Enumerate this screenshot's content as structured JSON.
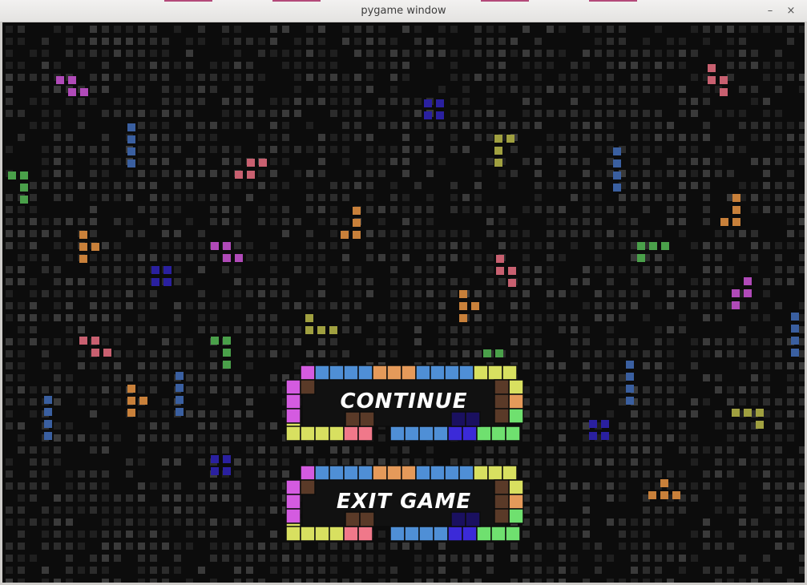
{
  "window": {
    "title": "pygame window",
    "minimize_glyph": "–",
    "close_glyph": "×"
  },
  "menu": {
    "continue_label": "CONTINUE",
    "exit_label": "EXIT GAME"
  },
  "colors": {
    "background": "#0c0c0c",
    "grid_dim": "#1f1f1f",
    "grid_mid": "#2c2c2c",
    "grid_bright": "#3a3a3a",
    "magenta": "#d45be0",
    "blue": "#4f8fd6",
    "orange": "#e59a5a",
    "yellow": "#d8e060",
    "pink": "#f0788a",
    "green": "#6fe06f",
    "dark_brown": "#5a3a28",
    "indigo": "#3b2ad8",
    "button_fill": "#111111"
  },
  "falling_pieces": [
    {
      "color": "#b04ab8"
    },
    {
      "color": "#3a5fa0"
    },
    {
      "color": "#4aa04a"
    },
    {
      "color": "#c86070"
    },
    {
      "color": "#c8803a"
    },
    {
      "color": "#2a20a0"
    },
    {
      "color": "#a0a040"
    }
  ]
}
